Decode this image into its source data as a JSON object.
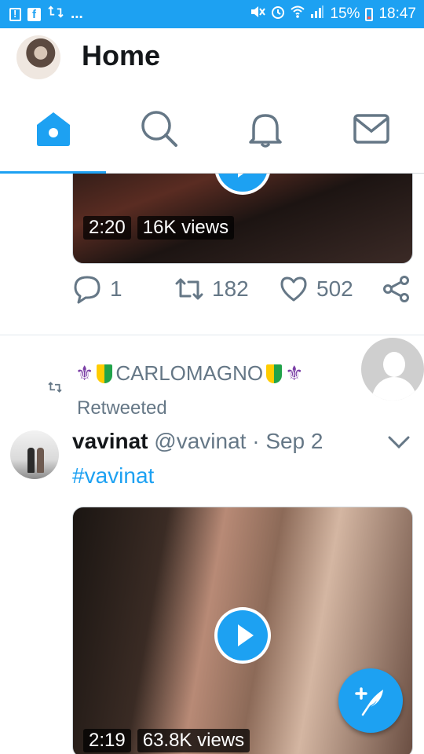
{
  "status_bar": {
    "battery_percent": "15%",
    "time": "18:47",
    "icons": [
      "alert-icon",
      "facebook-icon",
      "retweet-notification-icon",
      "more-notifications-icon",
      "mute-icon",
      "alarm-icon",
      "wifi-icon",
      "signal-icon",
      "battery-icon"
    ],
    "more_label": "..."
  },
  "header": {
    "title": "Home"
  },
  "tabs": [
    {
      "icon": "home-icon",
      "active": true
    },
    {
      "icon": "search-icon",
      "active": false
    },
    {
      "icon": "notifications-bell-icon",
      "active": false
    },
    {
      "icon": "messages-envelope-icon",
      "active": false
    }
  ],
  "tweet1": {
    "video": {
      "duration": "2:20",
      "views": "16K views"
    },
    "replies": "1",
    "retweets": "182",
    "likes": "502"
  },
  "tweet2": {
    "retweeted_by": "CARLOMAGNO",
    "retweeted_label": "Retweeted",
    "author_name": "vavinat",
    "author_handle": "@vavinat",
    "separator": "·",
    "date": "Sep 2",
    "text": "#vavinat",
    "video": {
      "duration": "2:19",
      "views": "63.8K views"
    }
  },
  "colors": {
    "accent": "#1da1f2",
    "muted": "#657786",
    "text": "#14171a"
  }
}
